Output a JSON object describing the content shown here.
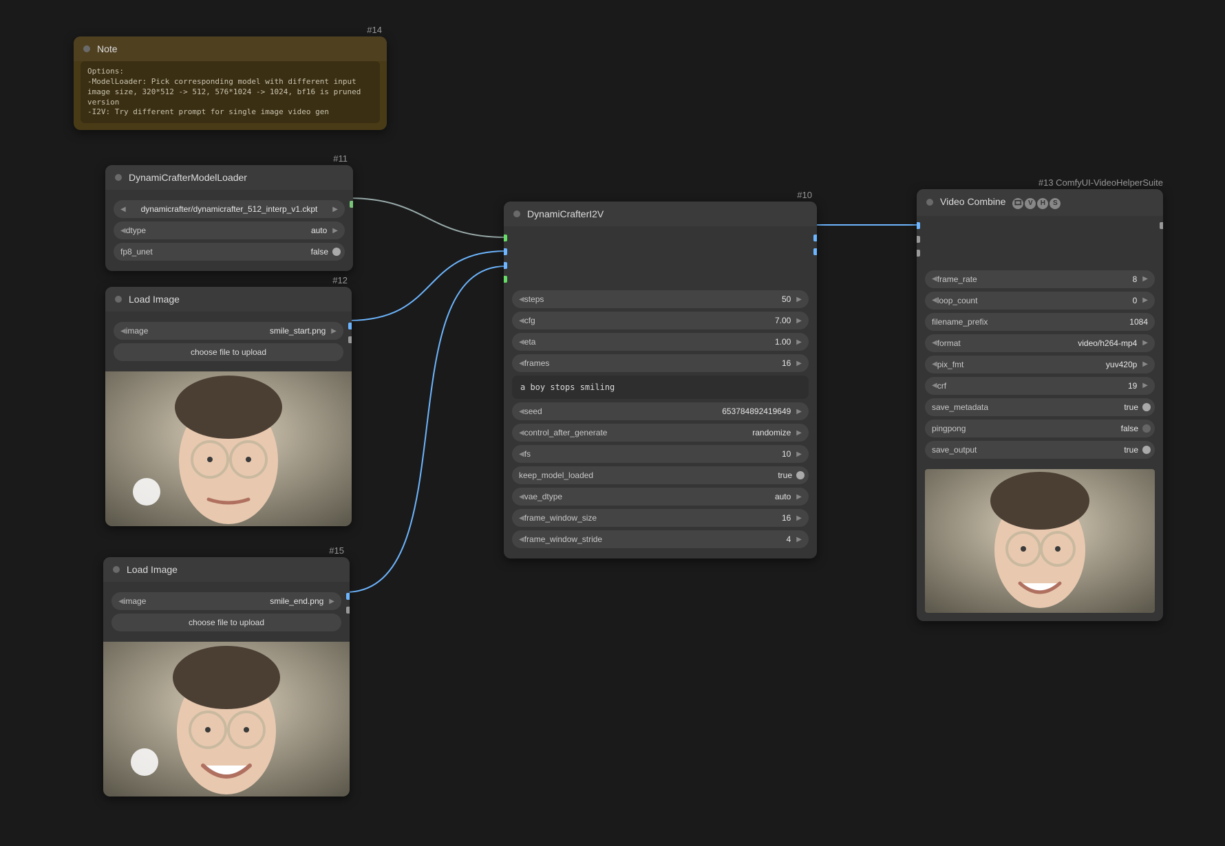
{
  "note": {
    "id": "#14",
    "title": "Note",
    "content": "Options:\n-ModelLoader: Pick corresponding model with different input image size, 320*512 -> 512, 576*1024 -> 1024, bf16 is pruned version\n-I2V: Try different prompt for single image video gen"
  },
  "modelLoader": {
    "id": "#11",
    "title": "DynamiCrafterModelLoader",
    "model_label": "dynamicrafter/dynamicrafter_512_interp_v1.ckpt",
    "dtype_label": "dtype",
    "dtype_value": "auto",
    "fp8_label": "fp8_unet",
    "fp8_value": "false"
  },
  "loadImage1": {
    "id": "#12",
    "title": "Load Image",
    "image_label": "image",
    "image_value": "smile_start.png",
    "upload": "choose file to upload"
  },
  "loadImage2": {
    "id": "#15",
    "title": "Load Image",
    "image_label": "image",
    "image_value": "smile_end.png",
    "upload": "choose file to upload"
  },
  "i2v": {
    "id": "#10",
    "title": "DynamiCrafterI2V",
    "steps_label": "steps",
    "steps_value": "50",
    "cfg_label": "cfg",
    "cfg_value": "7.00",
    "eta_label": "eta",
    "eta_value": "1.00",
    "frames_label": "frames",
    "frames_value": "16",
    "prompt": "a boy stops smiling",
    "seed_label": "seed",
    "seed_value": "653784892419649",
    "cag_label": "control_after_generate",
    "cag_value": "randomize",
    "fs_label": "fs",
    "fs_value": "10",
    "kml_label": "keep_model_loaded",
    "kml_value": "true",
    "vae_label": "vae_dtype",
    "vae_value": "auto",
    "fws_label": "frame_window_size",
    "fws_value": "16",
    "fwstr_label": "frame_window_stride",
    "fwstr_value": "4"
  },
  "videoCombine": {
    "id": "#13 ComfyUI-VideoHelperSuite",
    "title": "Video Combine",
    "fr_label": "frame_rate",
    "fr_value": "8",
    "lc_label": "loop_count",
    "lc_value": "0",
    "fp_label": "filename_prefix",
    "fp_value": "1084",
    "fmt_label": "format",
    "fmt_value": "video/h264-mp4",
    "pix_label": "pix_fmt",
    "pix_value": "yuv420p",
    "crf_label": "crf",
    "crf_value": "19",
    "sm_label": "save_metadata",
    "sm_value": "true",
    "pp_label": "pingpong",
    "pp_value": "false",
    "so_label": "save_output",
    "so_value": "true"
  }
}
